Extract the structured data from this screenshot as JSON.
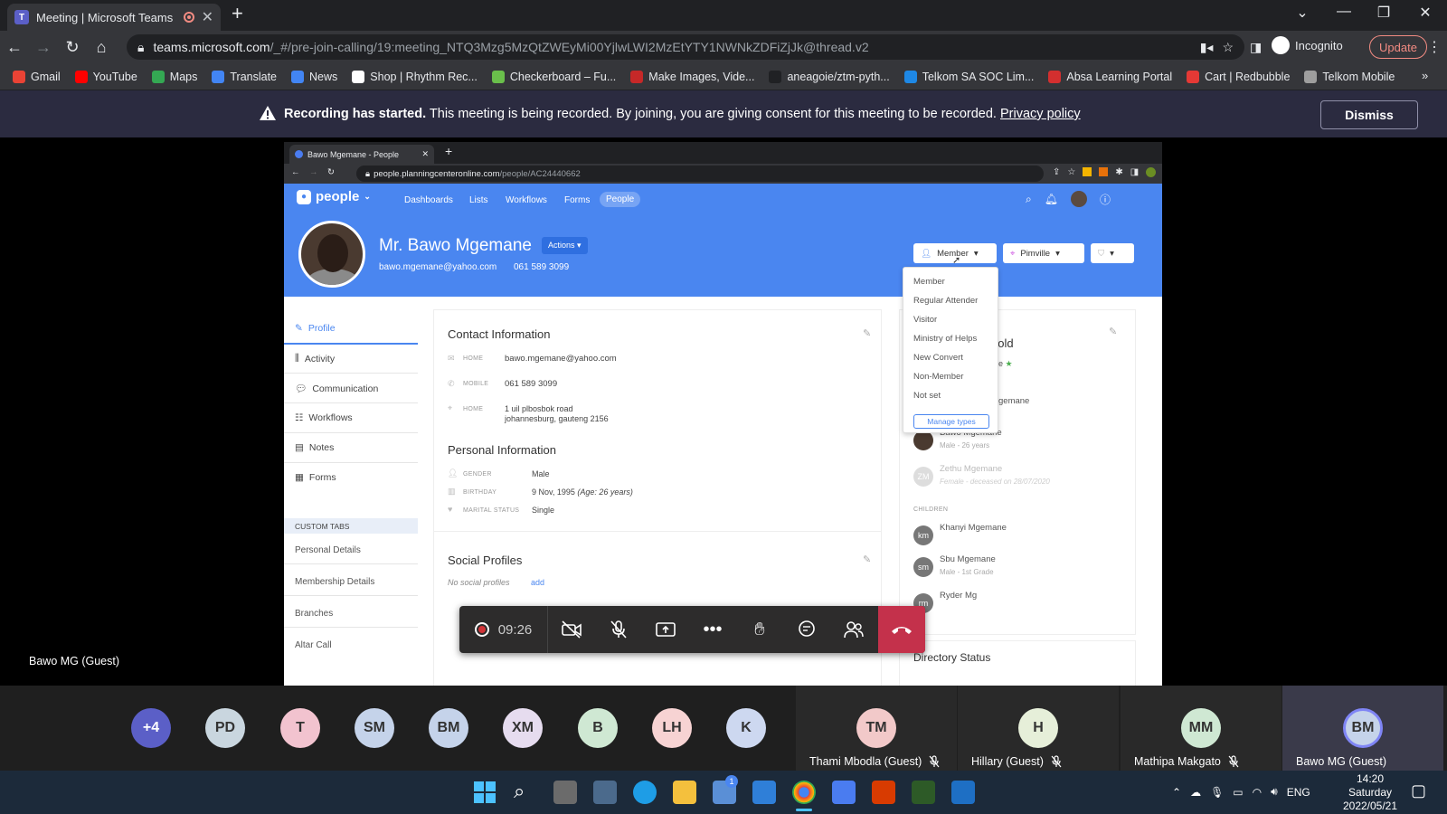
{
  "browser": {
    "tab_title": "Meeting | Microsoft Teams",
    "url_host": "teams.microsoft.com",
    "url_path": "/_#/pre-join-calling/19:meeting_NTQ3Mzg5MzQtZWEyMi00YjlwLWI2MzEtYTY1NWNkZDFiZjJk@thread.v2",
    "incognito_label": "Incognito",
    "update_label": "Update",
    "bookmarks": [
      {
        "label": "Gmail",
        "color": "#ea4335"
      },
      {
        "label": "YouTube",
        "color": "#ff0000"
      },
      {
        "label": "Maps",
        "color": "#34a853"
      },
      {
        "label": "Translate",
        "color": "#4285f4"
      },
      {
        "label": "News",
        "color": "#4285f4"
      },
      {
        "label": "Shop | Rhythm Rec...",
        "color": "#ffffff"
      },
      {
        "label": "Checkerboard – Fu...",
        "color": "#6abf4b"
      },
      {
        "label": "Make Images, Vide...",
        "color": "#c62828"
      },
      {
        "label": "aneagoie/ztm-pyth...",
        "color": "#202124"
      },
      {
        "label": "Telkom SA SOC Lim...",
        "color": "#1e88e5"
      },
      {
        "label": "Absa Learning Portal",
        "color": "#d32f2f"
      },
      {
        "label": "Cart | Redbubble",
        "color": "#e53935"
      },
      {
        "label": "Telkom Mobile",
        "color": "#9e9e9e"
      }
    ]
  },
  "banner": {
    "bold": "Recording has started.",
    "text": " This meeting is being recorded. By joining, you are giving consent for this meeting to be recorded. ",
    "link": "Privacy policy",
    "dismiss": "Dismiss"
  },
  "shared": {
    "tab_title": "Bawo Mgemane - People",
    "url_host": "people.planningcenteronline.com",
    "url_path": "/people/AC24440662",
    "app_name": "people",
    "nav": [
      "Dashboards",
      "Lists",
      "Workflows",
      "Forms",
      "People"
    ],
    "person": {
      "name": "Mr. Bawo Mgemane",
      "actions": "Actions ▾",
      "email": "bawo.mgemane@yahoo.com",
      "phone": "061 589 3099",
      "status": "Member",
      "campus": "Pimville"
    },
    "sidebar": [
      "Profile",
      "Activity",
      "Communication",
      "Workflows",
      "Notes",
      "Forms"
    ],
    "custom_tabs_header": "CUSTOM TABS",
    "custom_tabs": [
      "Personal Details",
      "Membership Details",
      "Branches",
      "Altar Call"
    ],
    "contact": {
      "title": "Contact Information",
      "email_label": "HOME",
      "email": "bawo.mgemane@yahoo.com",
      "mobile_label": "MOBILE",
      "mobile": "061 589 3099",
      "address_label": "HOME",
      "address1": "1 uil plbosbok road",
      "address2": "johannesburg, gauteng 2156"
    },
    "personal": {
      "title": "Personal Information",
      "gender_label": "GENDER",
      "gender": "Male",
      "birthday_label": "BIRTHDAY",
      "birthday": "9 Nov, 1995",
      "age": "(Age: 26 years)",
      "marital_label": "MARITAL STATUS",
      "marital": "Single"
    },
    "social": {
      "title": "Social Profiles",
      "none": "No social profiles",
      "add": "add"
    },
    "household": {
      "title_fragment": "hold",
      "frag_e": "e",
      "frag_name": "gemane",
      "members": [
        {
          "initials": "",
          "name": "Bawo Mgemane",
          "sub": "Male - 26 years"
        },
        {
          "initials": "ZM",
          "name": "Zethu Mgemane",
          "sub": "Female - deceased on 28/07/2020"
        }
      ],
      "children_label": "CHILDREN",
      "children": [
        {
          "initials": "km",
          "name": "Khanyi Mgemane",
          "sub": ""
        },
        {
          "initials": "sm",
          "name": "Sbu Mgemane",
          "sub": "Male - 1st Grade"
        },
        {
          "initials": "rm",
          "name": "Ryder Mg",
          "sub": ""
        }
      ]
    },
    "directory_title": "Directory Status",
    "dropdown": [
      "Member",
      "Regular Attender",
      "Visitor",
      "Ministry of Helps",
      "New Convert",
      "Non-Member",
      "Not set"
    ],
    "manage_types": "Manage types"
  },
  "call": {
    "timer": "09:26",
    "presenter": "Bawo MG (Guest)",
    "overflow_badge": "+4",
    "avatars": [
      {
        "initials": "PD",
        "color": "#c9d6df"
      },
      {
        "initials": "T",
        "color": "#f2c3cf"
      },
      {
        "initials": "SM",
        "color": "#c5d3ea"
      },
      {
        "initials": "BM",
        "color": "#c5d3ea"
      },
      {
        "initials": "XM",
        "color": "#e6dcef"
      },
      {
        "initials": "B",
        "color": "#cfe8d3"
      },
      {
        "initials": "LH",
        "color": "#f7d3d3"
      },
      {
        "initials": "K",
        "color": "#cdd8f0"
      }
    ],
    "tiles": [
      {
        "initials": "TM",
        "name": "Thami Mbodla (Guest)",
        "color": "#f2c9c9",
        "muted": true
      },
      {
        "initials": "H",
        "name": "Hillary (Guest)",
        "color": "#e6efd9",
        "muted": true
      },
      {
        "initials": "MM",
        "name": "Mathipa Makgato",
        "color": "#cfe8d3",
        "muted": true
      },
      {
        "initials": "BM",
        "name": "Bawo MG (Guest)",
        "color": "#c5d3ea",
        "muted": false
      }
    ]
  },
  "taskbar": {
    "lang": "ENG",
    "time": "14:20",
    "day": "Saturday",
    "date": "2022/05/21",
    "notification_badge": "1"
  }
}
